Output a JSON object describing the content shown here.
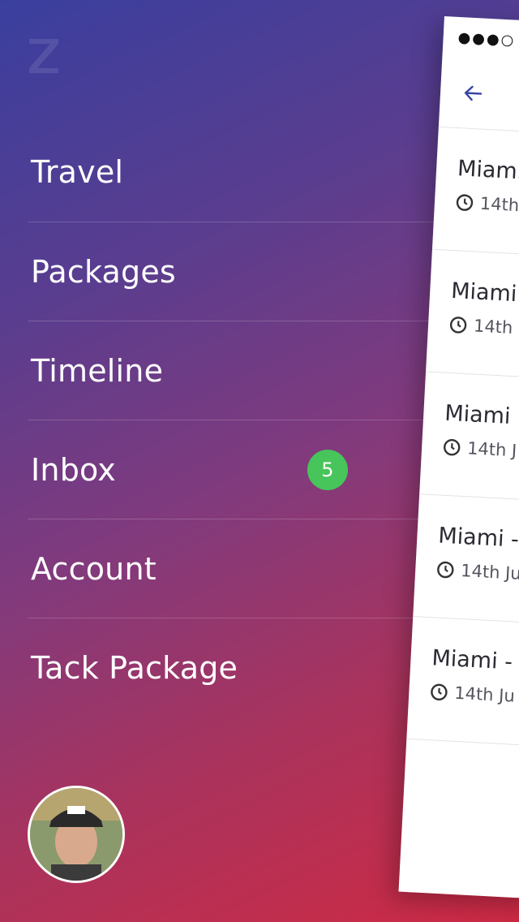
{
  "logo": {
    "icon": "z-logo-icon"
  },
  "menu": {
    "items": [
      {
        "label": "Travel"
      },
      {
        "label": "Packages"
      },
      {
        "label": "Timeline"
      },
      {
        "label": "Inbox",
        "badge": "5"
      },
      {
        "label": "Account"
      },
      {
        "label": "Tack Package"
      }
    ]
  },
  "badge_color": "#47c45a",
  "phone": {
    "status_text": "●●●○",
    "rows": [
      {
        "city": "Miami",
        "date": "14th"
      },
      {
        "city": "Miami",
        "date": "14th"
      },
      {
        "city": "Miami",
        "date": "14th J"
      },
      {
        "city": "Miami -",
        "date": "14th Ju"
      },
      {
        "city": "Miami -",
        "date": "14th Ju"
      }
    ]
  }
}
